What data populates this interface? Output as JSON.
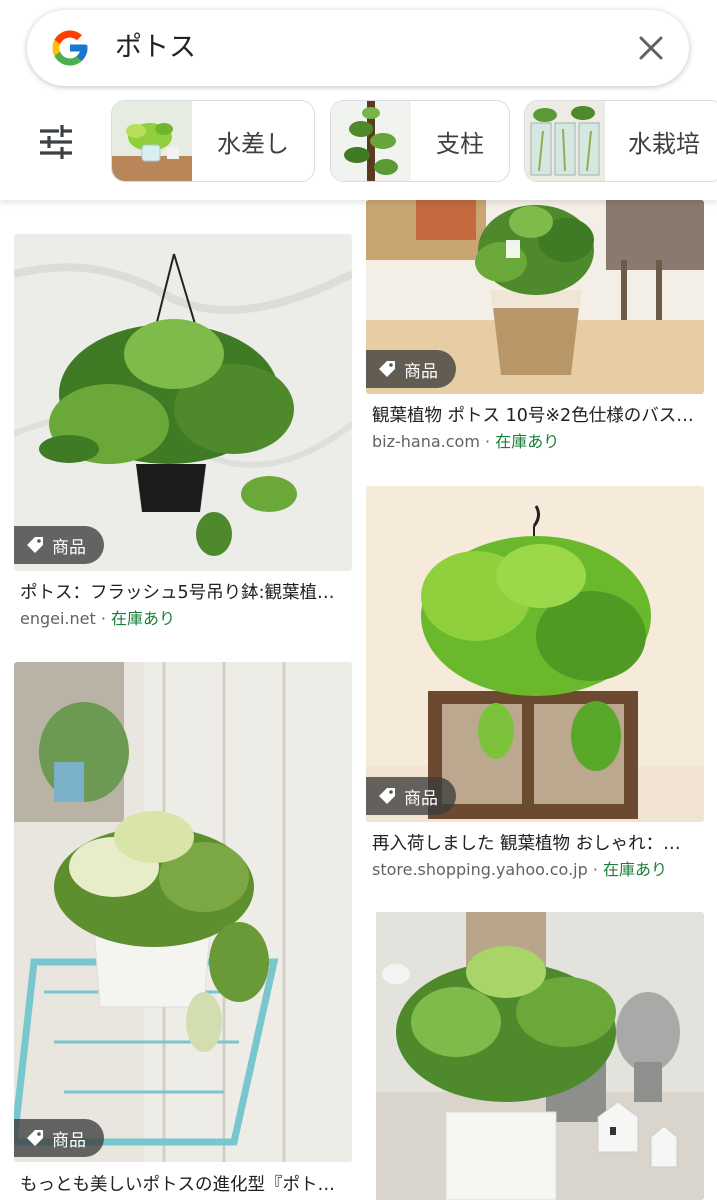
{
  "search": {
    "query": "ポトス",
    "clear_icon": "close-icon"
  },
  "filter_icon": "tune-icon",
  "chips": [
    {
      "label": "水差し"
    },
    {
      "label": "支柱"
    },
    {
      "label": "水栽培"
    }
  ],
  "results": [
    {
      "badge": "商品",
      "title": "観葉植物 ポトス 10号※2色仕様のバス…",
      "source": "biz-hana.com",
      "separator": " · ",
      "stock": "在庫あり"
    },
    {
      "badge": "商品",
      "title": "ポトス：フラッシュ5号吊り鉢:観葉植…",
      "source": "engei.net",
      "separator": " · ",
      "stock": "在庫あり"
    },
    {
      "badge": "商品",
      "title": "再入荷しました 観葉植物 おしゃれ：…",
      "source": "store.shopping.yahoo.co.jp",
      "separator": " · ",
      "stock": "在庫あり"
    },
    {
      "badge": "商品",
      "title": "もっとも美しいポトスの進化型『ポト…",
      "source": "",
      "separator": "",
      "stock": ""
    },
    {
      "badge": "",
      "title": "",
      "source": "",
      "separator": "",
      "stock": ""
    }
  ],
  "colors": {
    "stock_green": "#188038",
    "badge_bg": "#3c3c3c",
    "plant_green": "#4e8a2c"
  }
}
